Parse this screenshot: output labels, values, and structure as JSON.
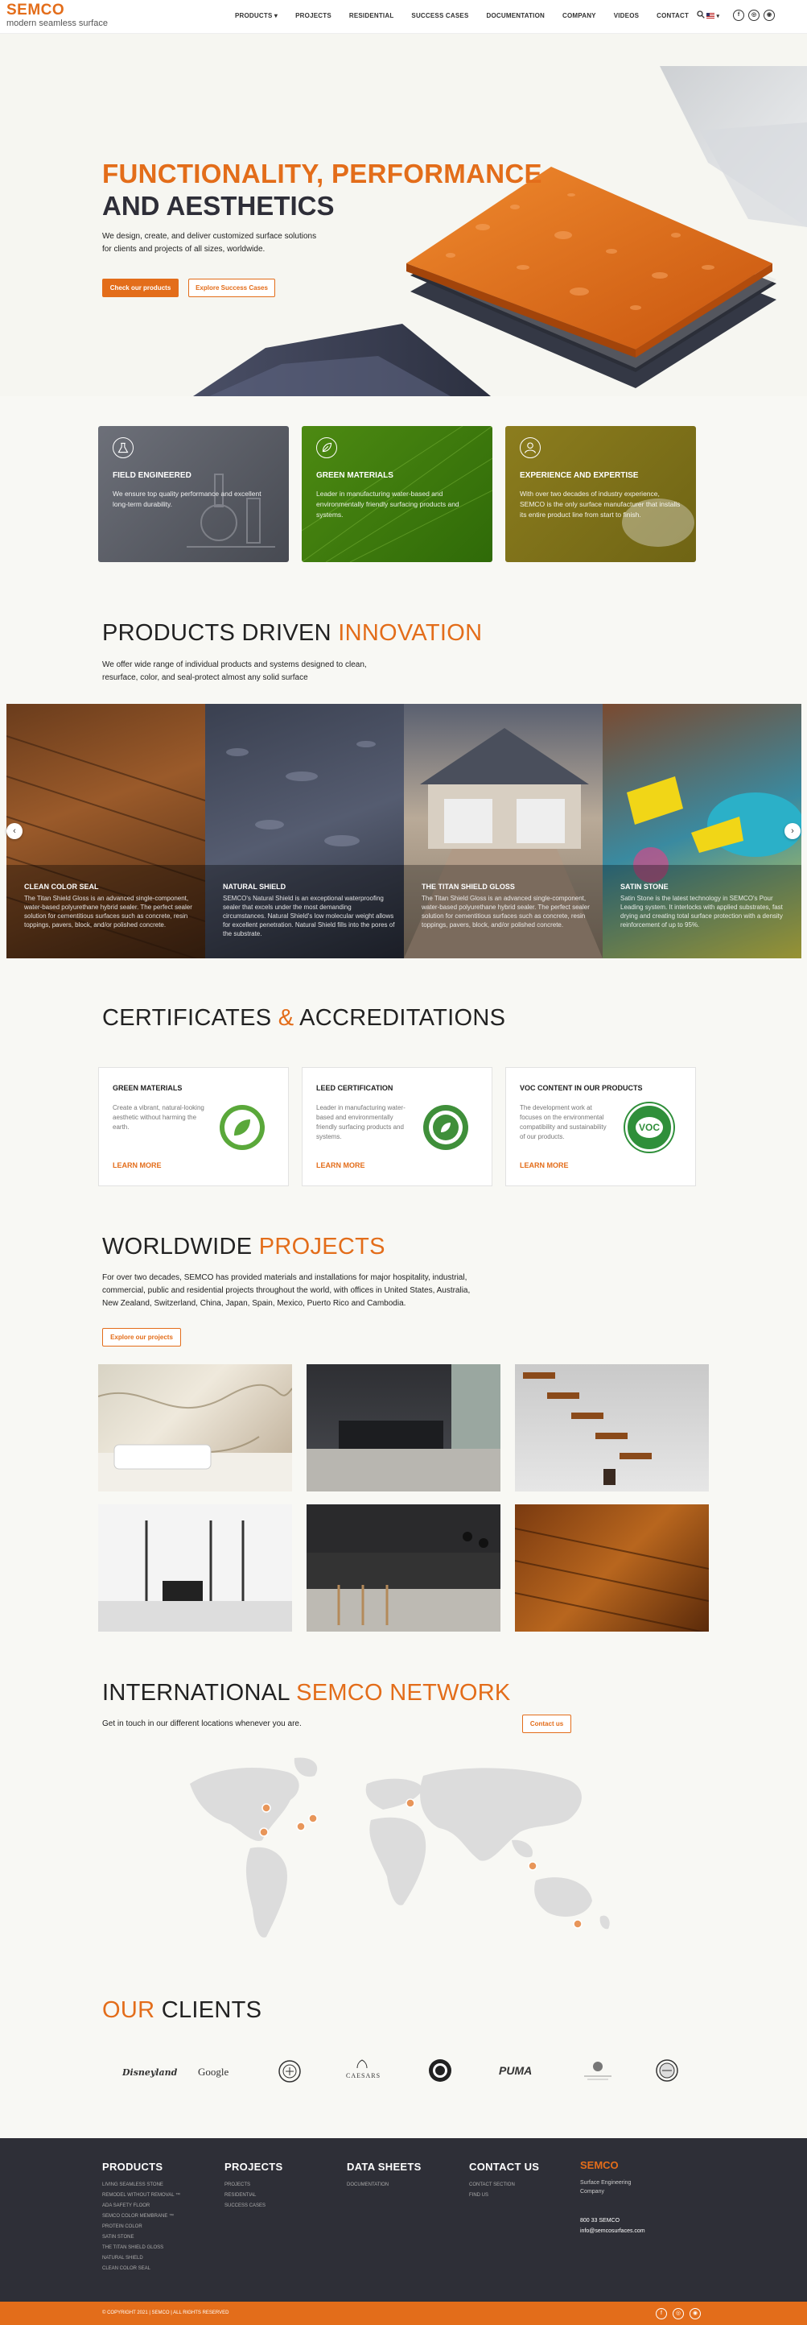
{
  "header": {
    "logo_brand": "SEMCO",
    "logo_tagline": "modern seamless surface",
    "nav": [
      "PRODUCTS ▾",
      "PROJECTS",
      "RESIDENTIAL",
      "SUCCESS CASES",
      "DOCUMENTATION",
      "COMPANY",
      "VIDEOS",
      "CONTACT"
    ],
    "lang_caret": "▾",
    "social": [
      "f",
      "◎",
      "◉"
    ]
  },
  "hero": {
    "title_line1": "FUNCTIONALITY, PERFORMANCE",
    "title_line2": "AND AESTHETICS",
    "subtitle": "We design, create, and deliver customized surface solutions for clients and projects of all sizes, worldwide.",
    "btn_primary": "Check our products",
    "btn_secondary": "Explore Success Cases"
  },
  "features": [
    {
      "title": "FIELD ENGINEERED",
      "text": "We ensure top quality performance and excellent long-term durability."
    },
    {
      "title": "GREEN MATERIALS",
      "text": "Leader in manufacturing water-based and environmentally friendly surfacing products and systems."
    },
    {
      "title": "EXPERIENCE AND EXPERTISE",
      "text": "With over two decades of industry experience, SEMCO is the only surface manufacturer that installs its entire product line from start to finish."
    }
  ],
  "products": {
    "heading_a": "PRODUCTS DRIVEN ",
    "heading_b": "INNOVATION",
    "intro": "We offer wide range of individual products and systems designed to clean, resurface, color, and seal-protect almost any solid surface",
    "slides": [
      {
        "title": "CLEAN COLOR SEAL",
        "text": "The Titan Shield Gloss is an advanced single-component, water-based polyurethane hybrid sealer. The perfect sealer solution for cementitious surfaces such as concrete, resin toppings, pavers, block, and/or polished concrete."
      },
      {
        "title": "NATURAL SHIELD",
        "text": "SEMCO's Natural Shield is an exceptional waterproofing sealer that excels under the most demanding circumstances. Natural Shield's low molecular weight allows for excellent penetration. Natural Shield fills into the pores of the substrate."
      },
      {
        "title": "THE TITAN SHIELD GLOSS",
        "text": "The Titan Shield Gloss is an advanced single-component, water-based polyurethane hybrid sealer. The perfect sealer solution for cementitious surfaces such as concrete, resin toppings, pavers, block, and/or polished concrete."
      },
      {
        "title": "SATIN STONE",
        "text": "Satin Stone is the latest technology in SEMCO's Pour Leading system. It interlocks with applied substrates, fast drying and creating total surface protection with a density reinforcement of up to 95%."
      }
    ],
    "prev": "‹",
    "next": "›"
  },
  "certificates": {
    "heading_a": "CERTIFICATES ",
    "heading_amp": "& ",
    "heading_b": "ACCREDITATIONS",
    "cards": [
      {
        "title": "GREEN MATERIALS",
        "text": "Create a vibrant, natural-looking aesthetic without harming the earth.",
        "link": "LEARN MORE"
      },
      {
        "title": "LEED CERTIFICATION",
        "text": "Leader in manufacturing water-based and environmentally friendly surfacing products and systems.",
        "link": "LEARN MORE"
      },
      {
        "title": "VOC CONTENT IN OUR PRODUCTS",
        "text": "The development work at focuses on the environmental compatibility and sustainability of our products.",
        "link": "LEARN MORE"
      }
    ],
    "badge_voc": "VOC"
  },
  "projects": {
    "heading_a": "WORLDWIDE ",
    "heading_b": "PROJECTS",
    "intro": "For over two decades, SEMCO has provided materials and installations for major hospitality, industrial, commercial, public and residential projects throughout the world, with offices in United States, Australia, New Zealand, Switzerland, China, Japan, Spain, Mexico, Puerto Rico and Cambodia.",
    "btn": "Explore our projects"
  },
  "network": {
    "heading_a": "INTERNATIONAL ",
    "heading_b": "SEMCO NETWORK",
    "intro": "Get in touch in our different locations whenever you are.",
    "btn": "Contact us"
  },
  "clients": {
    "heading_a": "OUR ",
    "heading_b": "CLIENTS",
    "logos": [
      "Disneyland",
      "Google",
      "",
      "CAESARS",
      "",
      "PUMA",
      "",
      ""
    ]
  },
  "footer": {
    "products_title": "PRODUCTS",
    "products_links": [
      "LIVING SEAMLESS STONE",
      "REMODEL WITHOUT REMOVAL ™",
      "ADA SAFETY FLOOR",
      "SEMCO COLOR MEMBRANE ™",
      "PROTEIN COLOR",
      "SATIN STONE",
      "THE TITAN SHIELD GLOSS",
      "NATURAL SHIELD",
      "CLEAN COLOR SEAL"
    ],
    "projects_title": "PROJECTS",
    "projects_links": [
      "PROJECTS",
      "RESIDENTIAL",
      "SUCCESS CASES"
    ],
    "datasheets_title": "DATA SHEETS",
    "datasheets_links": [
      "DOCUMENTATION"
    ],
    "contact_title": "CONTACT US",
    "contact_links": [
      "CONTACT SECTION",
      "FIND US"
    ],
    "brand": "SEMCO",
    "brand_line": "Surface Engineering Company",
    "phone": "800 33 SEMCO",
    "email": "info@semcosurfaces.com",
    "copyright": "© COPYRIGHT 2021 | SEMCO | ALL RIGHTS RESERVED",
    "social": [
      "f",
      "◎",
      "◉"
    ]
  }
}
